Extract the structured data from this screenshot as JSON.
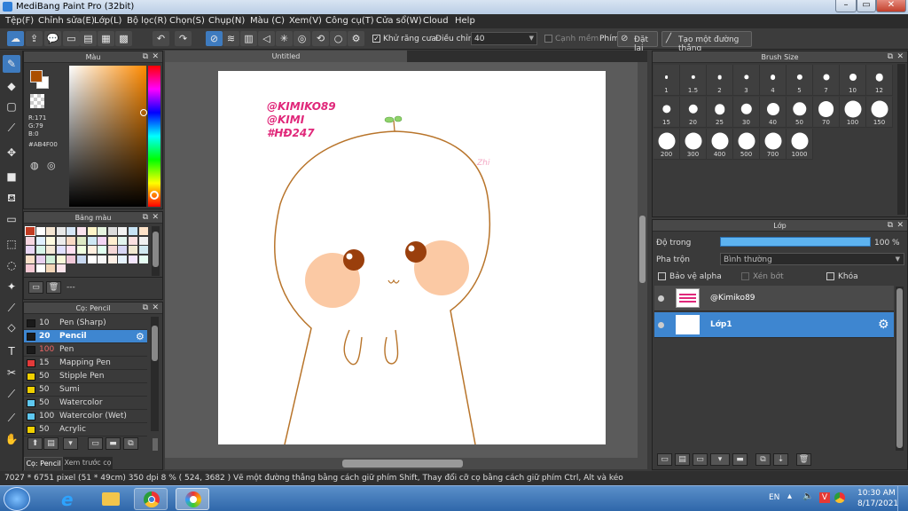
{
  "window": {
    "title": "MediBang Paint Pro (32bit)",
    "min_label": "–",
    "max_label": "▭",
    "close_label": "✕"
  },
  "menu": [
    "Tệp(F)",
    "Chỉnh sửa(E)",
    "Lớp(L)",
    "Bộ lọc(R)",
    "Chọn(S)",
    "Chụp(N)",
    "Màu (C)",
    "Xem(V)",
    "Công cụ(T)",
    "Cửa sổ(W)",
    "Cloud",
    "Help"
  ],
  "toolbar": {
    "antialias_label": "Khử răng cưa",
    "adjust_label": "Điều chỉnh",
    "adjust_value": "40",
    "sharp_edge_label": "Cạnh mềm",
    "key_label": "Phím",
    "reset_label": "Đặt lại",
    "straight_line_label": "Tạo một đường thẳng"
  },
  "color_panel": {
    "title": "Màu",
    "r": "R:171",
    "g": "G:79",
    "b": "B:0",
    "hex": "#AB4F00",
    "main_color": "#AB4F00"
  },
  "palette_panel": {
    "title": "Bảng màu",
    "dash": "---"
  },
  "brush_list": {
    "title": "Cọ: Pencil",
    "items": [
      {
        "size": "10",
        "name": "Pen (Sharp)",
        "color": "#1a1a1a"
      },
      {
        "size": "20",
        "name": "Pencil",
        "color": "#1a1a1a"
      },
      {
        "size": "100",
        "name": "Pen",
        "color": "#1a1a1a"
      },
      {
        "size": "15",
        "name": "Mapping Pen",
        "color": "#e33a3a"
      },
      {
        "size": "50",
        "name": "Stipple Pen",
        "color": "#f0d000"
      },
      {
        "size": "50",
        "name": "Sumi",
        "color": "#f0d000"
      },
      {
        "size": "50",
        "name": "Watercolor",
        "color": "#5ec8f0"
      },
      {
        "size": "100",
        "name": "Watercolor (Wet)",
        "color": "#5ec8f0"
      },
      {
        "size": "50",
        "name": "Acrylic",
        "color": "#f0d000"
      }
    ],
    "tab1": "Cọ: Pencil",
    "tab2": "Xem trước cọ"
  },
  "canvas": {
    "tab_title": "Untitled",
    "watermark_lines": [
      "@KIMIKO89",
      "@KIMI",
      "#HĐ247"
    ],
    "signature": "Zhi"
  },
  "brush_size_panel": {
    "title": "Brush Size",
    "sizes": [
      "1",
      "1.5",
      "2",
      "3",
      "4",
      "5",
      "7",
      "10",
      "12",
      "15",
      "20",
      "25",
      "30",
      "40",
      "50",
      "70",
      "100",
      "150",
      "200",
      "300",
      "400",
      "500",
      "700",
      "1000"
    ]
  },
  "layer_panel": {
    "title": "Lớp",
    "opacity_label": "Độ trong",
    "opacity_value": "100 %",
    "blend_label": "Pha trộn",
    "blend_value": "Bình thường",
    "protect_alpha": "Bảo vệ alpha",
    "clip": "Xén bớt",
    "lock": "Khóa",
    "layers": [
      "@Kimiko89",
      "Lớp1"
    ]
  },
  "status": {
    "text": "7027 * 6751 pixel  (51 * 49cm)  350 dpi  8 %  ( 524, 3682 )  Vẽ một đường thẳng bằng cách giữ phím Shift, Thay đổi cỡ cọ bằng cách giữ phím Ctrl, Alt và kéo"
  },
  "taskbar": {
    "lang": "EN",
    "time": "10:30 AM",
    "date": "8/17/2021"
  },
  "colors": {
    "accent": "#3e86d0",
    "brand_pink": "#e0287a",
    "line_brown": "#b8742a",
    "cheek": "#fbc9a4"
  }
}
